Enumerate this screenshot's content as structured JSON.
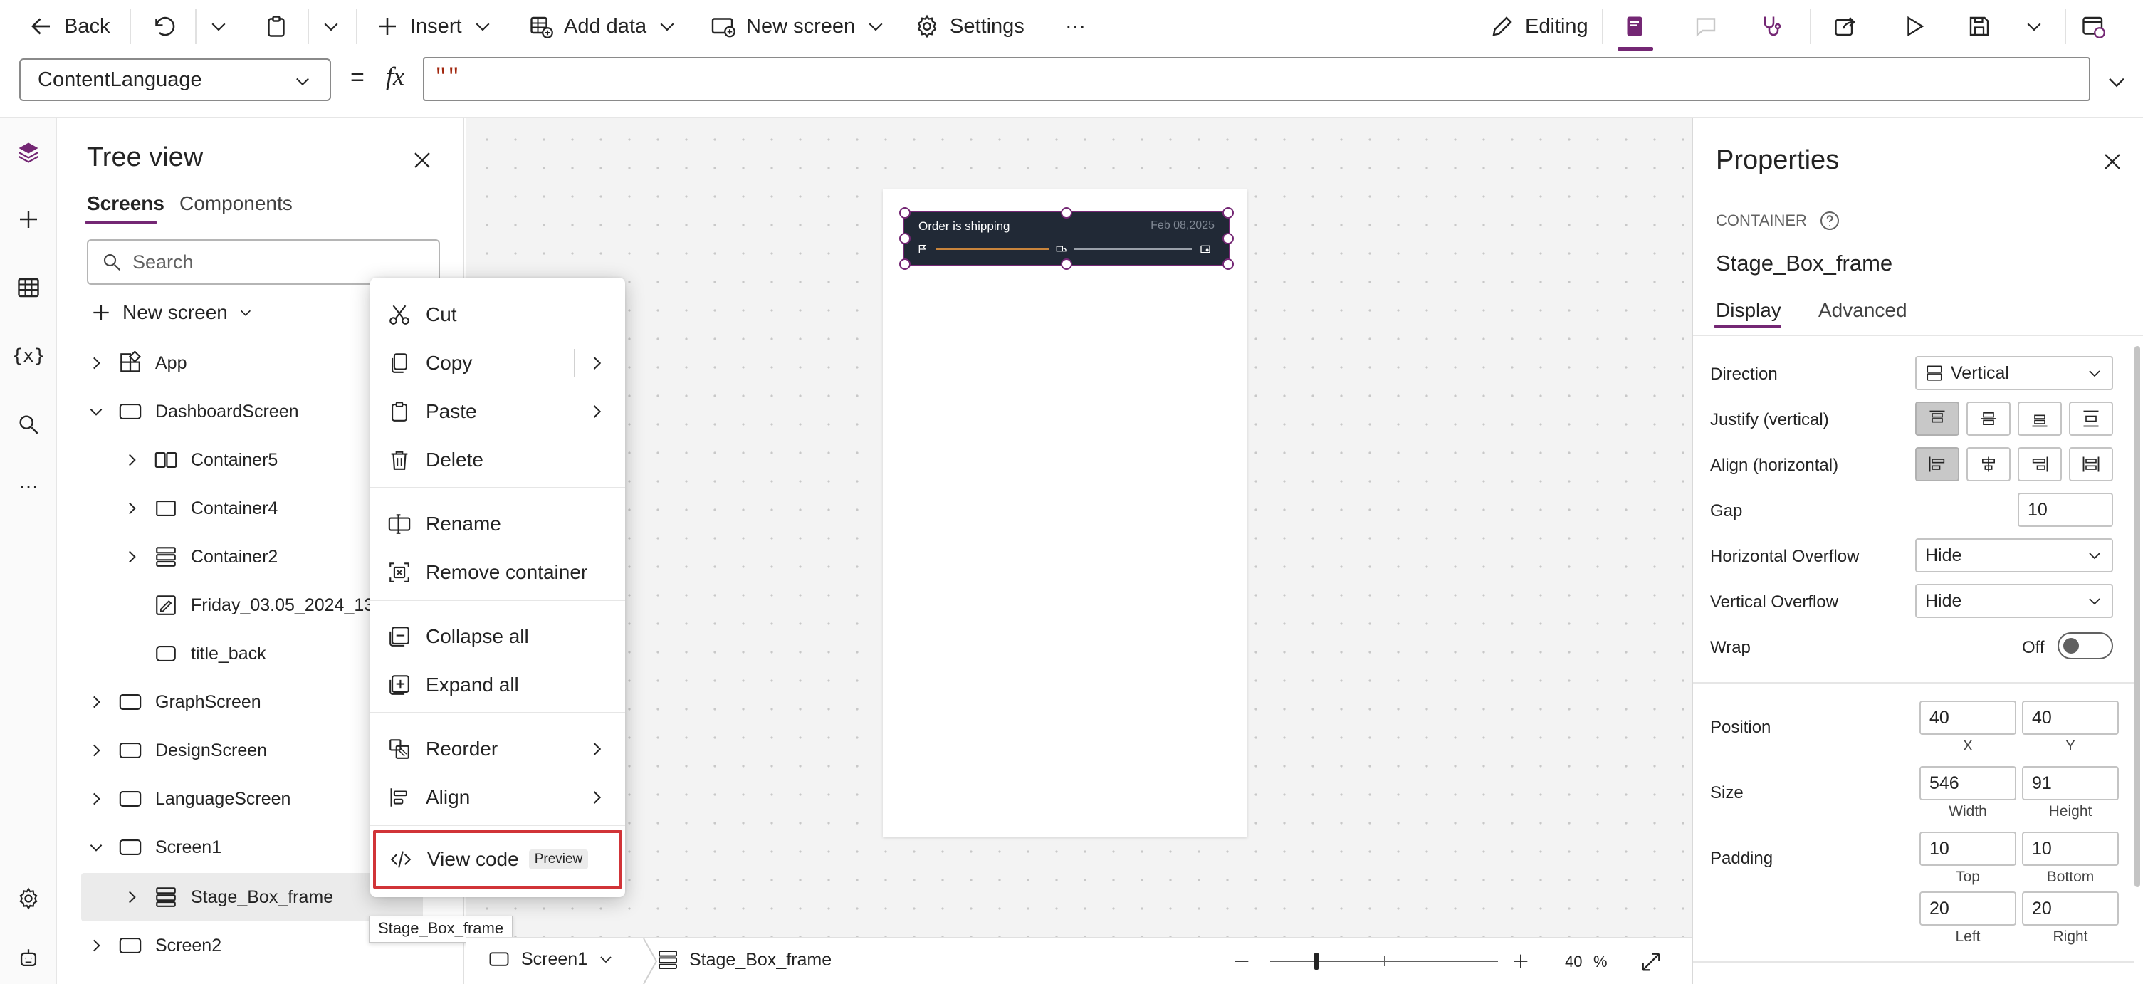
{
  "toolbar": {
    "back_label": "Back",
    "insert_label": "Insert",
    "add_data_label": "Add data",
    "new_screen_label": "New screen",
    "settings_label": "Settings",
    "more_label": "···",
    "editing_label": "Editing"
  },
  "formula": {
    "property": "ContentLanguage",
    "equals": "=",
    "fx": "fx",
    "value": "\"\""
  },
  "tree": {
    "title": "Tree view",
    "tabs": [
      "Screens",
      "Components"
    ],
    "search_placeholder": "Search",
    "new_screen_label": "New screen",
    "nodes": [
      "App",
      "DashboardScreen",
      "Container5",
      "Container4",
      "Container2",
      "Friday_03.05_2024_13",
      "title_back",
      "GraphScreen",
      "DesignScreen",
      "LanguageScreen",
      "Screen1",
      "Stage_Box_frame",
      "Screen2"
    ],
    "more_label": "···",
    "tooltip": "Stage_Box_frame"
  },
  "context_menu": {
    "items": [
      "Cut",
      "Copy",
      "Paste",
      "Delete",
      "Rename",
      "Remove container",
      "Collapse all",
      "Expand all",
      "Reorder",
      "Align",
      "View code"
    ],
    "preview_badge": "Preview"
  },
  "canvas": {
    "card_title": "Order is shipping",
    "card_date": "Feb 08,2025"
  },
  "status_bar": {
    "screen": "Screen1",
    "control": "Stage_Box_frame",
    "zoom_value": "40",
    "zoom_unit": "%"
  },
  "properties": {
    "title": "Properties",
    "type_label": "CONTAINER",
    "control_name": "Stage_Box_frame",
    "tabs": [
      "Display",
      "Advanced"
    ],
    "direction_label": "Direction",
    "direction_value": "Vertical",
    "justify_label": "Justify (vertical)",
    "align_label": "Align (horizontal)",
    "gap_label": "Gap",
    "gap_value": "10",
    "h_overflow_label": "Horizontal Overflow",
    "h_overflow_value": "Hide",
    "v_overflow_label": "Vertical Overflow",
    "v_overflow_value": "Hide",
    "wrap_label": "Wrap",
    "wrap_value": "Off",
    "position_label": "Position",
    "x_value": "40",
    "y_value": "40",
    "x_caption": "X",
    "y_caption": "Y",
    "size_label": "Size",
    "width_value": "546",
    "height_value": "91",
    "width_caption": "Width",
    "height_caption": "Height",
    "padding_label": "Padding",
    "pad_top": "10",
    "pad_bottom": "10",
    "pad_left": "20",
    "pad_right": "20",
    "top_caption": "Top",
    "bottom_caption": "Bottom",
    "left_caption": "Left",
    "right_caption": "Right"
  },
  "colors": {
    "accent": "#742774",
    "highlight_border": "#d13438",
    "card_bg": "#212936"
  }
}
